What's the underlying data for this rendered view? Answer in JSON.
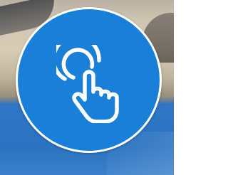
{
  "scene": {
    "icon": "tap-touch-icon",
    "badge_color": "#1a7fd6",
    "badge_border_color": "#ffffff",
    "icon_color": "#ffffff",
    "background_bottom_color": "#2b73c1"
  }
}
